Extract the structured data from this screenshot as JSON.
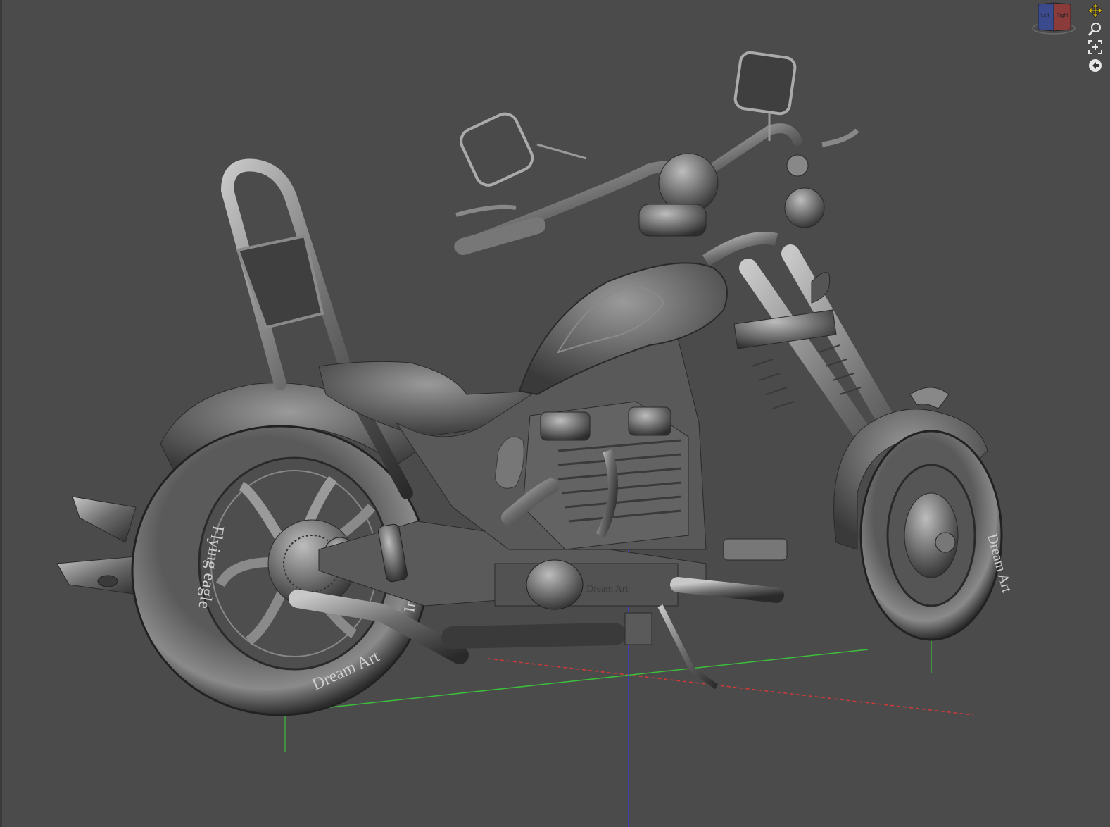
{
  "viewcube": {
    "faces": [
      "Left",
      "Right"
    ],
    "color_left": "#3b4a8c",
    "color_right": "#8c3b3b"
  },
  "navigation_tools": [
    {
      "name": "pan-icon",
      "color": "#d8b600"
    },
    {
      "name": "zoom-icon",
      "color": "#e6e6e6"
    },
    {
      "name": "zoom-extents-icon",
      "color": "#e6e6e6"
    },
    {
      "name": "orbit-icon",
      "color": "#e6e6e6"
    }
  ],
  "model": {
    "rear_tire_text": [
      "Flying eagle",
      "Dream Art",
      "Insool"
    ],
    "front_tire_text": "Dream Art",
    "engine_plate": "Dream Art"
  },
  "axes": {
    "x_color": "#d23a3a",
    "y_color": "#3cbf3c",
    "z_color": "#3b3bd6"
  }
}
